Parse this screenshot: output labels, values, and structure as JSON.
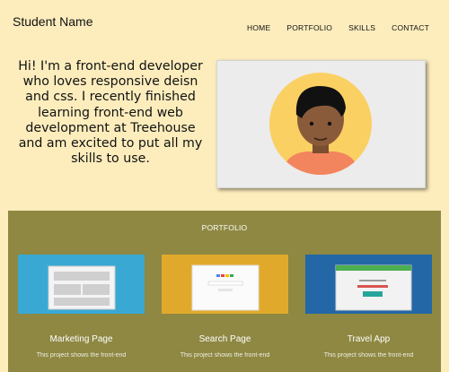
{
  "header": {
    "brand": "Student Name",
    "nav": [
      "HOME",
      "PORTFOLIO",
      "SKILLS",
      "CONTACT"
    ]
  },
  "hero": {
    "intro": "Hi! I'm a front-end developer who loves responsive deisn and css. I recently finished learning front-end web development at Treehouse and am excited to put all my skills to use."
  },
  "portfolio": {
    "title": "PORTFOLIO",
    "projects": [
      {
        "name": "Marketing Page",
        "desc": "This project shows the front-end",
        "color": "#39a9d4"
      },
      {
        "name": "Search Page",
        "desc": "This project shows the front-end",
        "color": "#e1a92b"
      },
      {
        "name": "Travel App",
        "desc": "This project shows the front-end",
        "color": "#2467a6"
      }
    ]
  },
  "colors": {
    "background": "#fdedbd",
    "portfolio_bg": "#8e8842",
    "avatar_circle": "#fbd063",
    "avatar_shirt": "#f2845e",
    "avatar_skin": "#8a5b3a",
    "avatar_hair": "#111111"
  },
  "icons": [
    "avatar-illustration"
  ]
}
